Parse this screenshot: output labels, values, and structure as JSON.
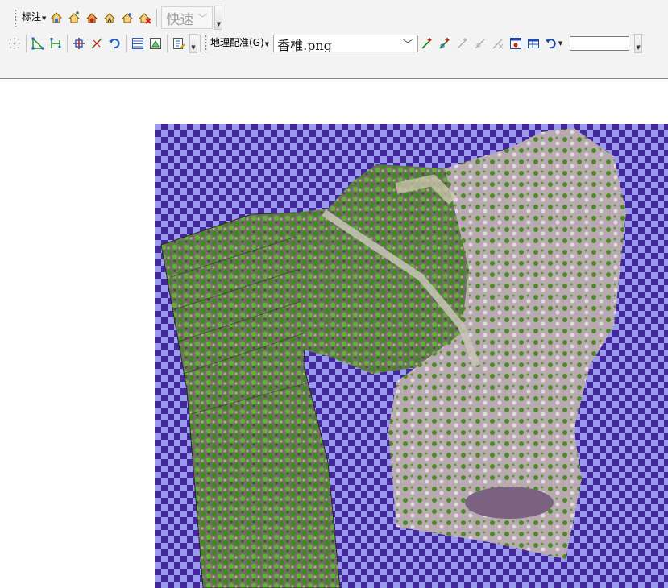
{
  "toolbar1": {
    "annotation_label": "标注",
    "quick_combo_value": "快速"
  },
  "toolbar2": {
    "georef_label": "地理配准(G)",
    "layer_combo_value": "香椎.png",
    "rotation_value": ""
  },
  "colors": {
    "toolbar_bg": "#f3f3f3",
    "checker_dark": "#44279a",
    "checker_light": "#9a9aee",
    "vegetation": "#3f8a1f",
    "bare_ground": "#b8aab0"
  }
}
